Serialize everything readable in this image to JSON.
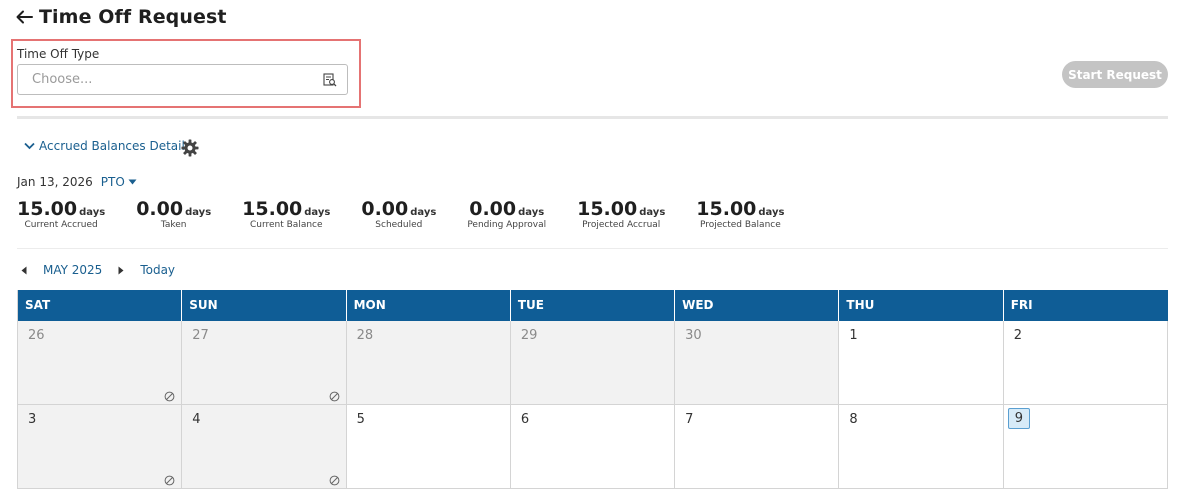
{
  "header": {
    "title": "Time Off Request",
    "back_icon": "arrow-left-icon"
  },
  "type_field": {
    "label": "Time Off Type",
    "placeholder": "Choose...",
    "value": "",
    "icon": "list-search-icon"
  },
  "start_button": {
    "label": "Start Request",
    "enabled": false
  },
  "balances": {
    "toggle_label": "Accrued Balances Details",
    "date": "Jan 13, 2026",
    "type": "PTO",
    "metrics": [
      {
        "value": "15.00",
        "unit": "days",
        "label": "Current Accrued"
      },
      {
        "value": "0.00",
        "unit": "days",
        "label": "Taken"
      },
      {
        "value": "15.00",
        "unit": "days",
        "label": "Current Balance"
      },
      {
        "value": "0.00",
        "unit": "days",
        "label": "Scheduled"
      },
      {
        "value": "0.00",
        "unit": "days",
        "label": "Pending Approval"
      },
      {
        "value": "15.00",
        "unit": "days",
        "label": "Projected Accrual"
      },
      {
        "value": "15.00",
        "unit": "days",
        "label": "Projected Balance"
      }
    ]
  },
  "calendar": {
    "month_label": "MAY 2025",
    "today_label": "Today",
    "header_color": "#0f5d96",
    "days_of_week": [
      "SAT",
      "SUN",
      "MON",
      "TUE",
      "WED",
      "THU",
      "FRI"
    ],
    "weeks": [
      [
        {
          "day": "26",
          "other_month": true,
          "unavailable": true
        },
        {
          "day": "27",
          "other_month": true,
          "unavailable": true
        },
        {
          "day": "28",
          "other_month": true,
          "unavailable": false
        },
        {
          "day": "29",
          "other_month": true,
          "unavailable": false
        },
        {
          "day": "30",
          "other_month": true,
          "unavailable": false
        },
        {
          "day": "1",
          "other_month": false,
          "unavailable": false
        },
        {
          "day": "2",
          "other_month": false,
          "unavailable": false
        }
      ],
      [
        {
          "day": "3",
          "other_month": false,
          "unavailable": true
        },
        {
          "day": "4",
          "other_month": false,
          "unavailable": true
        },
        {
          "day": "5",
          "other_month": false,
          "unavailable": false
        },
        {
          "day": "6",
          "other_month": false,
          "unavailable": false
        },
        {
          "day": "7",
          "other_month": false,
          "unavailable": false
        },
        {
          "day": "8",
          "other_month": false,
          "unavailable": false
        },
        {
          "day": "9",
          "other_month": false,
          "unavailable": false,
          "today": true
        }
      ]
    ]
  }
}
